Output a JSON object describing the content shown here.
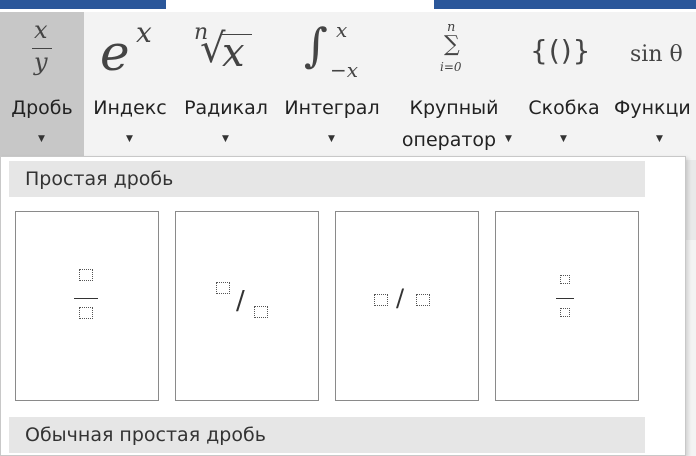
{
  "ribbon": {
    "buttons": [
      {
        "id": "fraction",
        "label": "Дробь",
        "icon": "fraction-icon",
        "glyph_top": "x",
        "glyph_bottom": "y"
      },
      {
        "id": "script",
        "label": "Индекс",
        "icon": "exponent-icon",
        "glyph_base": "e",
        "glyph_sup": "x"
      },
      {
        "id": "radical",
        "label": "Радикал",
        "icon": "radical-icon",
        "glyph_index": "n",
        "glyph_body": "x"
      },
      {
        "id": "integral",
        "label": "Интеграл",
        "icon": "integral-icon",
        "glyph_upper": "x",
        "glyph_lower": "−x"
      },
      {
        "id": "large-operator",
        "label_line1": "Крупный",
        "label_line2": "оператор",
        "icon": "summation-icon",
        "glyph_upper": "n",
        "glyph_lower": "i=0"
      },
      {
        "id": "bracket",
        "label": "Скобка",
        "icon": "bracket-icon",
        "glyph": "{()}"
      },
      {
        "id": "function",
        "label": "Функци",
        "icon": "function-icon",
        "glyph": "sin θ"
      }
    ]
  },
  "dropdown": {
    "section1_title": "Простая дробь",
    "section2_title": "Обычная простая дробь",
    "items": [
      {
        "name": "stacked-fraction",
        "icon": "stacked-fraction-icon"
      },
      {
        "name": "skewed-fraction",
        "icon": "skewed-fraction-icon"
      },
      {
        "name": "linear-fraction",
        "icon": "linear-fraction-icon"
      },
      {
        "name": "small-fraction",
        "icon": "small-fraction-icon"
      }
    ]
  },
  "colors": {
    "ribbon_bg": "#f3f3f3",
    "selected_bg": "#c7c7c7",
    "title_bar": "#2b579a"
  }
}
